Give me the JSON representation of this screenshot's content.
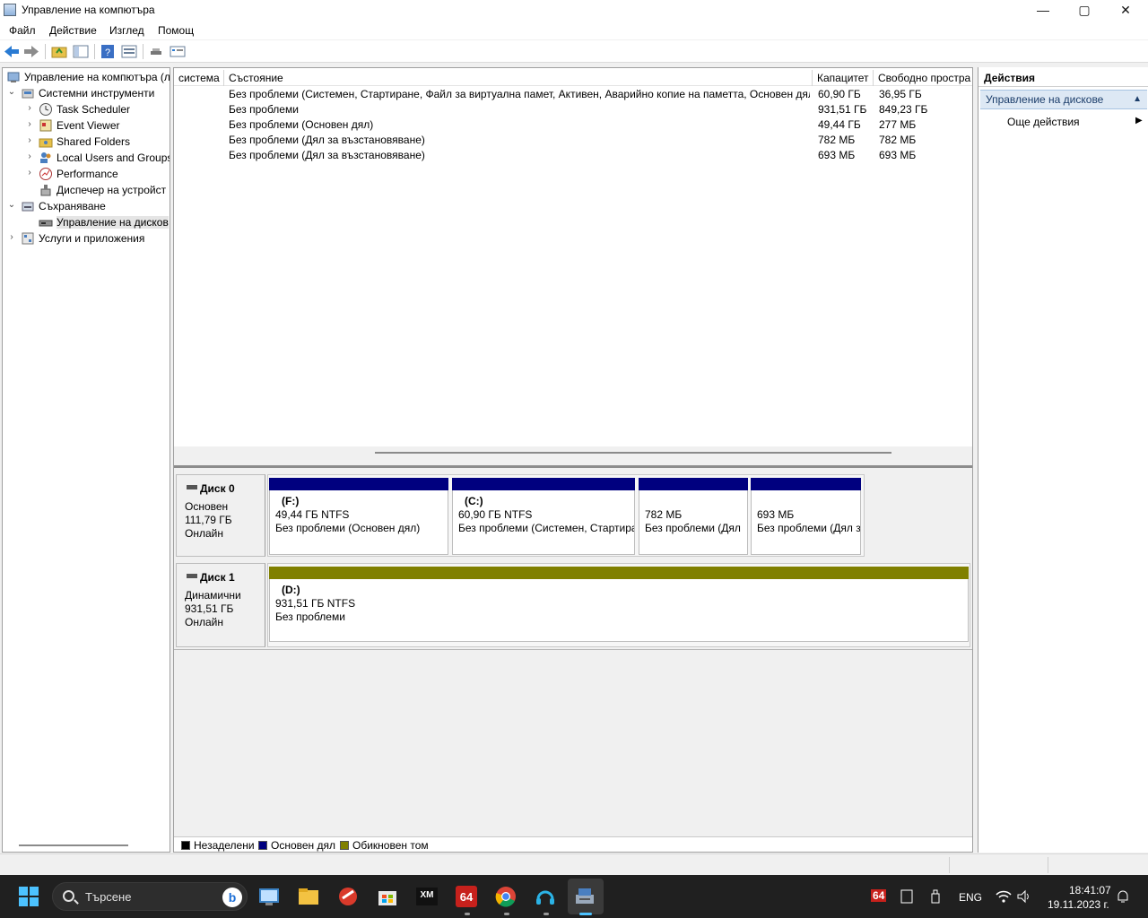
{
  "window": {
    "title": "Управление на компютъра",
    "controls": {
      "minimize": "—",
      "maximize": "▢",
      "close": "✕"
    }
  },
  "menu": [
    "Файл",
    "Действие",
    "Изглед",
    "Помощ"
  ],
  "tree": {
    "items": [
      {
        "label": "Управление на компютъра (л",
        "level": 0,
        "expander": "",
        "icon": "computer-management-icon"
      },
      {
        "label": "Системни инструменти",
        "level": 0,
        "expander": "open",
        "icon": "system-tools-icon"
      },
      {
        "label": "Task Scheduler",
        "level": 1,
        "expander": "closed",
        "icon": "clock-icon"
      },
      {
        "label": "Event Viewer",
        "level": 1,
        "expander": "closed",
        "icon": "event-viewer-icon"
      },
      {
        "label": "Shared Folders",
        "level": 1,
        "expander": "closed",
        "icon": "shared-folder-icon"
      },
      {
        "label": "Local Users and Groups",
        "level": 1,
        "expander": "closed",
        "icon": "users-icon"
      },
      {
        "label": "Performance",
        "level": 1,
        "expander": "closed",
        "icon": "performance-icon"
      },
      {
        "label": "Диспечер на устройст",
        "level": 1,
        "expander": "",
        "icon": "device-manager-icon"
      },
      {
        "label": "Съхраняване",
        "level": 0,
        "expander": "open",
        "icon": "storage-icon"
      },
      {
        "label": "Управление на дисков",
        "level": 1,
        "expander": "",
        "icon": "disk-management-icon",
        "selected": true
      },
      {
        "label": "Услуги и приложения",
        "level": 0,
        "expander": "closed",
        "icon": "services-icon"
      }
    ]
  },
  "volume_list": {
    "columns": [
      "система",
      "Състояние",
      "Капацитет",
      "Свободно простра"
    ],
    "rows": [
      {
        "status": "Без проблеми (Системен, Стартиране, Файл за виртуална памет, Активен, Аварийно копие на паметта, Основен дял)",
        "capacity": "60,90 ГБ",
        "free": "36,95 ГБ"
      },
      {
        "status": "Без проблеми",
        "capacity": "931,51 ГБ",
        "free": "849,23 ГБ"
      },
      {
        "status": "Без проблеми (Основен дял)",
        "capacity": "49,44 ГБ",
        "free": "277 МБ"
      },
      {
        "status": "Без проблеми (Дял за възстановяване)",
        "capacity": "782 МБ",
        "free": "782 МБ"
      },
      {
        "status": "Без проблеми (Дял за възстановяване)",
        "capacity": "693 МБ",
        "free": "693 МБ"
      }
    ]
  },
  "disks": [
    {
      "name": "Диск 0",
      "type": "Основен",
      "size": "111,79 ГБ",
      "state": "Онлайн",
      "partitions": [
        {
          "letter": "(F:)",
          "size": "49,44 ГБ NTFS",
          "status": "Без проблеми (Основен дял)",
          "color": "#00007f"
        },
        {
          "letter": "(C:)",
          "size": "60,90 ГБ NTFS",
          "status": "Без проблеми (Системен, Стартира",
          "color": "#00007f"
        },
        {
          "letter": "",
          "size": "782 МБ",
          "status": "Без проблеми (Дял",
          "color": "#00007f"
        },
        {
          "letter": "",
          "size": "693 МБ",
          "status": "Без проблеми (Дял з",
          "color": "#00007f"
        }
      ]
    },
    {
      "name": "Диск 1",
      "type": "Динамични",
      "size": "931,51 ГБ",
      "state": "Онлайн",
      "partitions": [
        {
          "letter": "(D:)",
          "size": "931,51 ГБ NTFS",
          "status": "Без проблеми",
          "color": "#808000"
        }
      ]
    }
  ],
  "legend": [
    {
      "label": "Незаделени",
      "color": "#000000"
    },
    {
      "label": "Основен дял",
      "color": "#00007f"
    },
    {
      "label": "Обикновен том",
      "color": "#808000"
    }
  ],
  "actions": {
    "header": "Действия",
    "section": "Управление на дискове",
    "more": "Още действия"
  },
  "taskbar": {
    "search_placeholder": "Търсене",
    "apps": [
      "start-icon",
      "bing-icon",
      "control-panel-icon",
      "file-explorer-icon",
      "ccleaner-icon",
      "microsoft-store-icon",
      "xmplay-icon",
      "aida64-icon",
      "chrome-icon",
      "headset-icon",
      "computer-management-taskbar-icon"
    ],
    "tray_badge": "64",
    "language": "ENG",
    "time": "18:41:07",
    "date": "19.11.2023 г."
  },
  "colors": {
    "primary_partition": "#00007f",
    "simple_volume": "#808000",
    "selection": "#e5e5e5"
  }
}
